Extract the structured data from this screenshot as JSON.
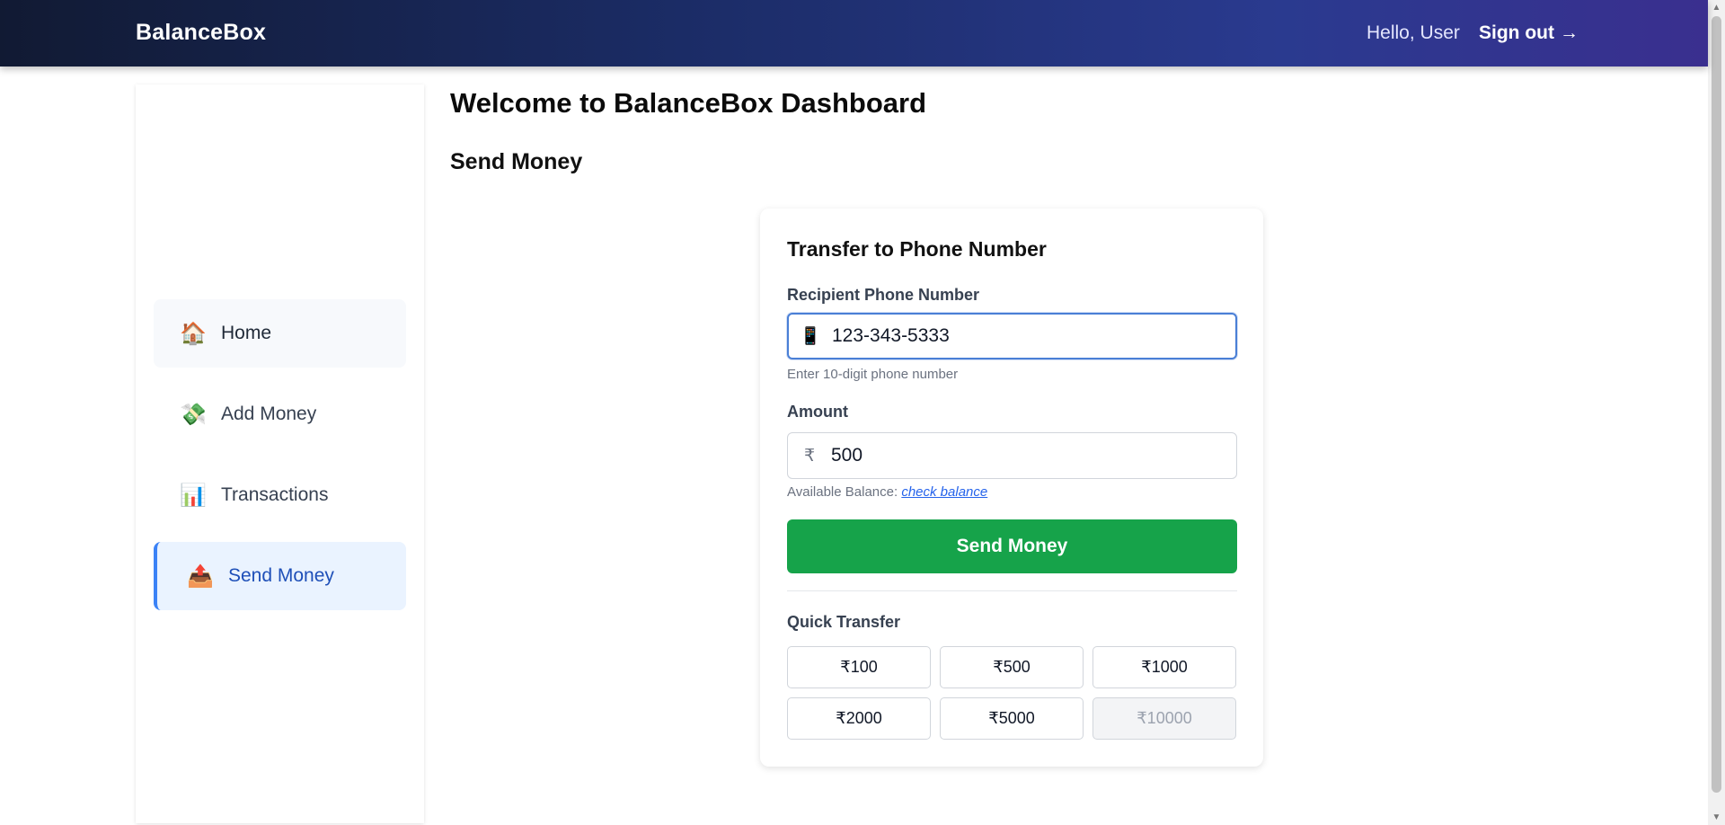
{
  "header": {
    "brand": "BalanceBox",
    "greeting": "Hello, User",
    "signout_label": "Sign out",
    "signout_arrow": "→"
  },
  "sidebar": {
    "items": [
      {
        "label": "Home",
        "icon": "house-icon",
        "glyph": "🏠"
      },
      {
        "label": "Add Money",
        "icon": "money-icon",
        "glyph": "💸"
      },
      {
        "label": "Transactions",
        "icon": "chart-icon",
        "glyph": "📊"
      },
      {
        "label": "Send Money",
        "icon": "outbox-tray-icon",
        "glyph": "📤"
      }
    ],
    "active": "Send Money"
  },
  "main": {
    "title": "Welcome to BalanceBox Dashboard",
    "section": "Send Money"
  },
  "form": {
    "title": "Transfer to Phone Number",
    "phone_label": "Recipient Phone Number",
    "phone_glyph": "📱",
    "phone_value": "123-343-5333",
    "phone_hint": "Enter 10-digit phone number",
    "amount_label": "Amount",
    "currency_symbol": "₹",
    "amount_value": "500",
    "balance_label": "Available Balance:",
    "balance_link": "check balance",
    "submit_label": "Send Money",
    "quick_label": "Quick Transfer",
    "quick_amounts": [
      "₹100",
      "₹500",
      "₹1000",
      "₹2000",
      "₹5000",
      "₹10000"
    ],
    "quick_disabled": "₹10000"
  },
  "colors": {
    "accent": "#3b82f6",
    "submit": "#16a34a",
    "link": "#2563eb"
  }
}
